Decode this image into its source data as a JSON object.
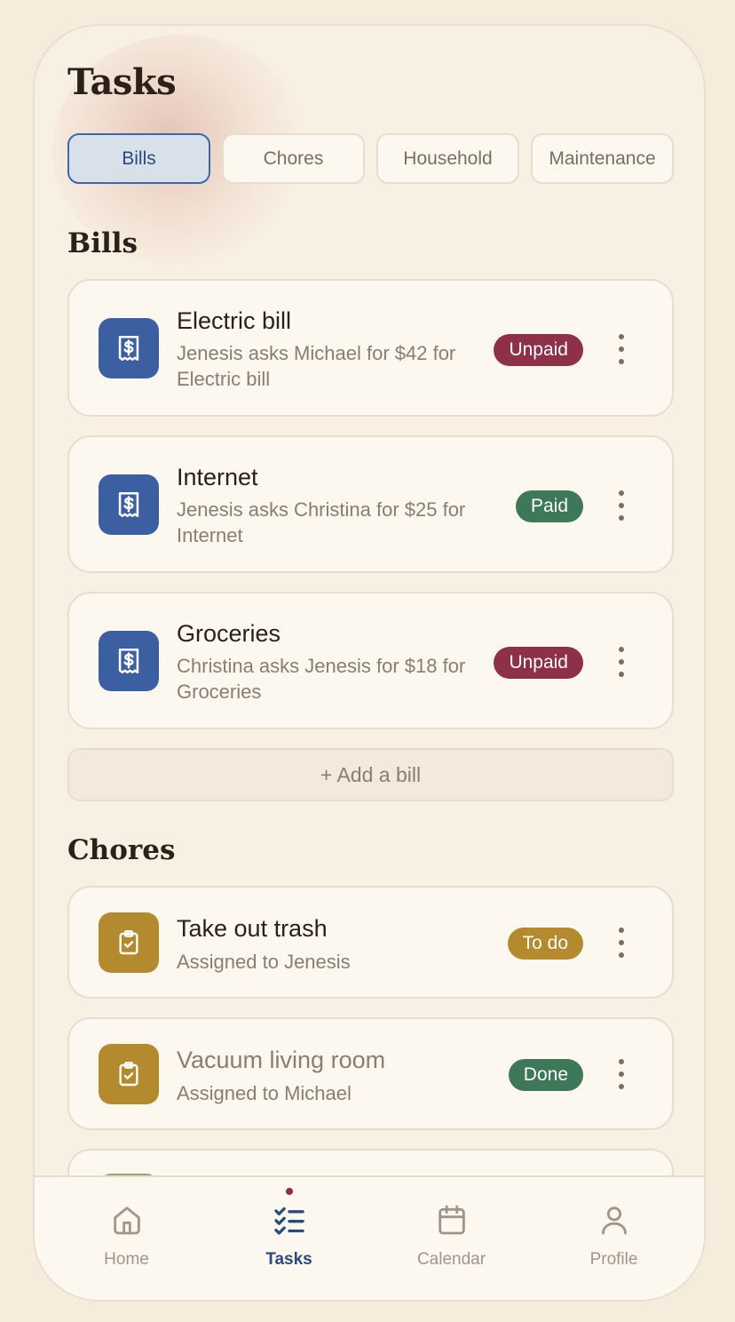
{
  "header": {
    "title": "Tasks"
  },
  "tabs": [
    {
      "label": "Bills",
      "active": true
    },
    {
      "label": "Chores",
      "active": false
    },
    {
      "label": "Household",
      "active": false
    },
    {
      "label": "Maintenance",
      "active": false
    }
  ],
  "bills": {
    "section_title": "Bills",
    "items": [
      {
        "title": "Electric bill",
        "subtitle": "Jenesis asks Michael for $42 for Electric bill",
        "status": "Unpaid",
        "icon": "receipt-dollar-icon"
      },
      {
        "title": "Internet",
        "subtitle": "Jenesis asks Christina for $25 for Internet",
        "status": "Paid",
        "icon": "receipt-dollar-icon"
      },
      {
        "title": "Groceries",
        "subtitle": "Christina asks Jenesis for $18 for Groceries",
        "status": "Unpaid",
        "icon": "receipt-dollar-icon"
      }
    ],
    "add_label": "+ Add a bill"
  },
  "chores": {
    "section_title": "Chores",
    "items": [
      {
        "title": "Take out trash",
        "subtitle": "Assigned to Jenesis",
        "status": "To do",
        "icon": "clipboard-check-icon"
      },
      {
        "title": "Vacuum living room",
        "subtitle": "Assigned to Michael",
        "status": "Done",
        "icon": "clipboard-check-icon"
      }
    ]
  },
  "nav": {
    "items": [
      {
        "label": "Home",
        "icon": "home-icon"
      },
      {
        "label": "Tasks",
        "icon": "tasks-icon",
        "active": true
      },
      {
        "label": "Calendar",
        "icon": "calendar-icon"
      },
      {
        "label": "Profile",
        "icon": "user-icon"
      }
    ]
  },
  "colors": {
    "primary": "#3b5fa0",
    "unpaid": "#8e3048",
    "paid": "#3d7858",
    "chore": "#b38a2e",
    "background": "#f8f0e2"
  }
}
